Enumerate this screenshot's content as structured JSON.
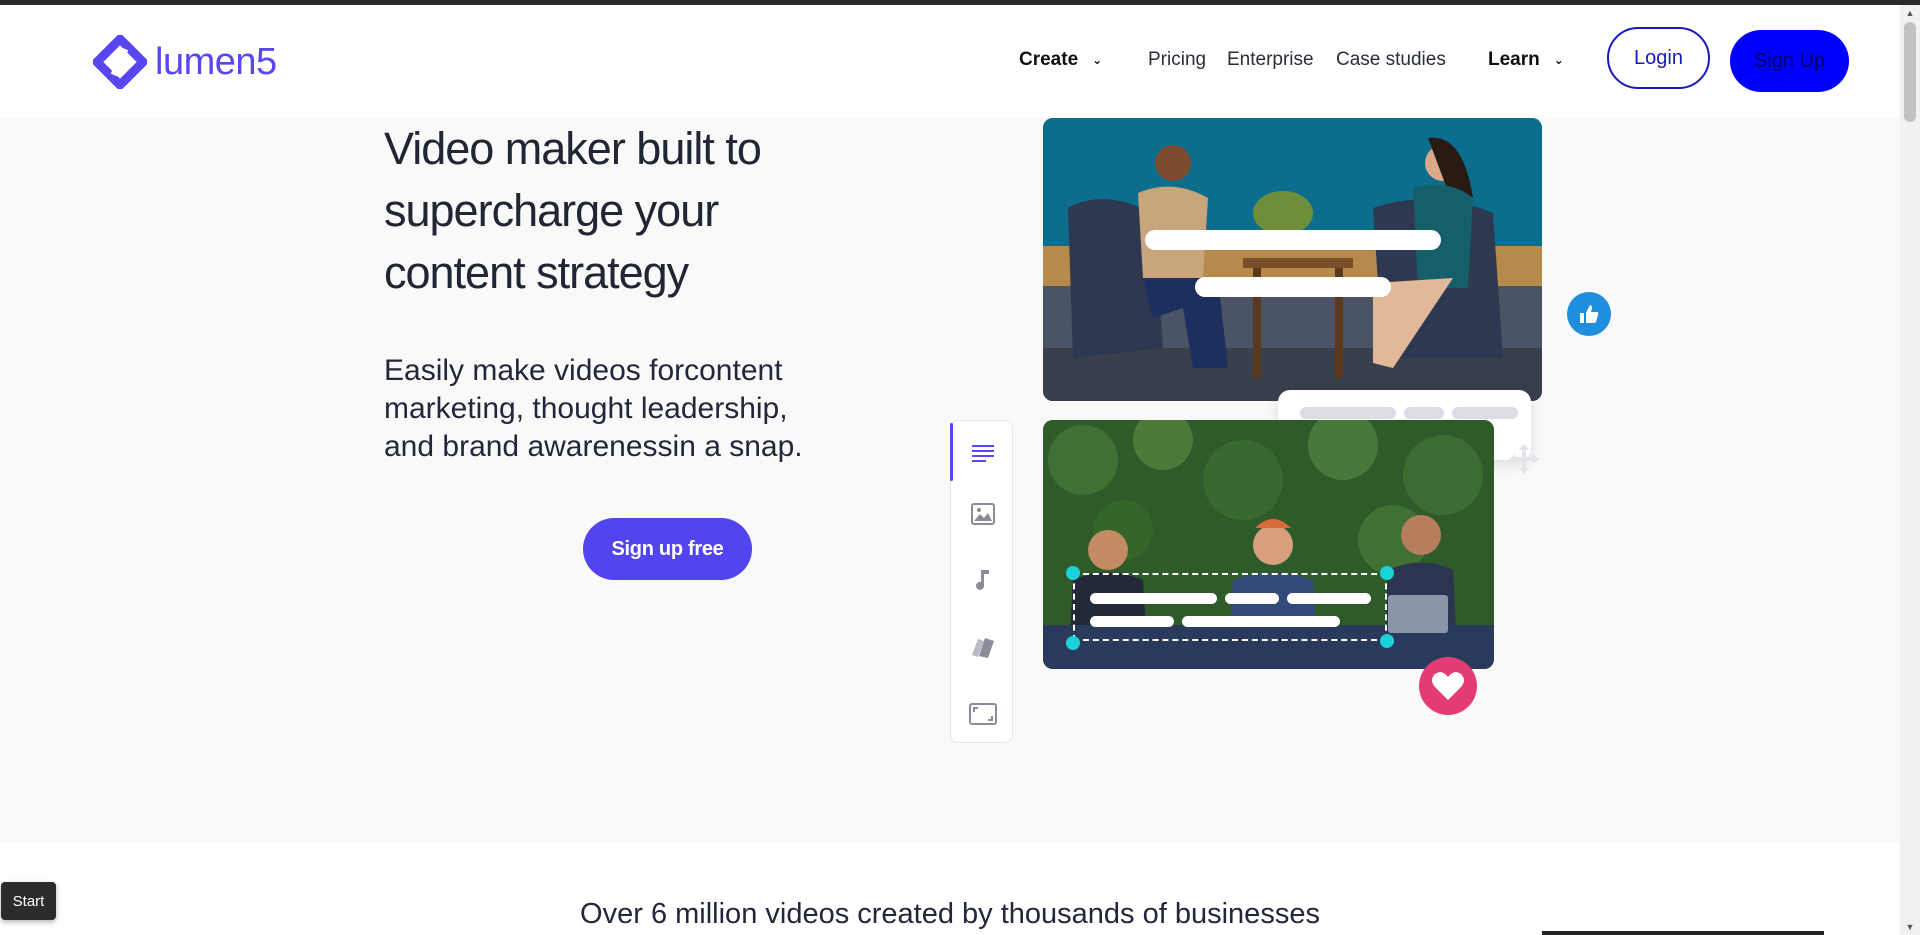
{
  "header": {
    "logo_text": "lumen5",
    "nav": {
      "create": "Create",
      "pricing": "Pricing",
      "enterprise": "Enterprise",
      "case_studies": "Case studies",
      "learn": "Learn"
    },
    "login_label": "Login",
    "signup_label": "Sign Up"
  },
  "hero": {
    "title_lines": [
      "Video maker built to",
      "supercharge your",
      "content strategy"
    ],
    "subtitle_lines": [
      "Easily make videos forcontent",
      "marketing, thought leadership,",
      "and brand awarenessin a snap."
    ],
    "cta_label": "Sign up free"
  },
  "editor_panel": {
    "icons": [
      "text-lines-icon",
      "image-icon",
      "music-note-icon",
      "color-swatch-icon",
      "aspect-ratio-icon"
    ]
  },
  "trust_text": "Over 6 million videos created by thousands of businesses",
  "start_button_label": "Start",
  "colors": {
    "brand": "#5846f0",
    "cta": "#5244ee",
    "signup_bg": "#0000ff",
    "like": "#1f8fdd",
    "heart": "#e33b76",
    "handle": "#19d3d8"
  }
}
